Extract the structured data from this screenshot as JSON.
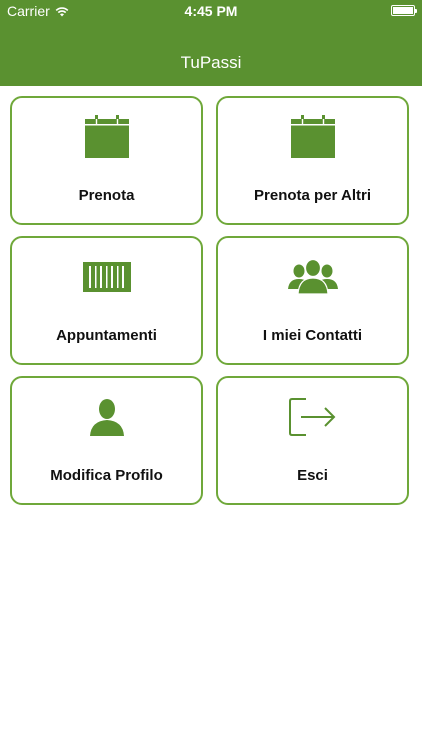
{
  "status_bar": {
    "carrier": "Carrier",
    "time": "4:45 PM",
    "battery_level": 1.0
  },
  "header": {
    "title": "TuPassi"
  },
  "menu": [
    {
      "label": "Prenota",
      "icon": "calendar-icon"
    },
    {
      "label": "Prenota per Altri",
      "icon": "calendar-icon"
    },
    {
      "label": "Appuntamenti",
      "icon": "barcode-icon"
    },
    {
      "label": "I miei Contatti",
      "icon": "contacts-group-icon"
    },
    {
      "label": "Modifica Profilo",
      "icon": "profile-icon"
    },
    {
      "label": "Esci",
      "icon": "logout-icon"
    }
  ],
  "colors": {
    "header_background": "#5a9130",
    "tile_border": "#6fa83a",
    "icon_green": "#5a9130",
    "label_text": "#111111"
  }
}
